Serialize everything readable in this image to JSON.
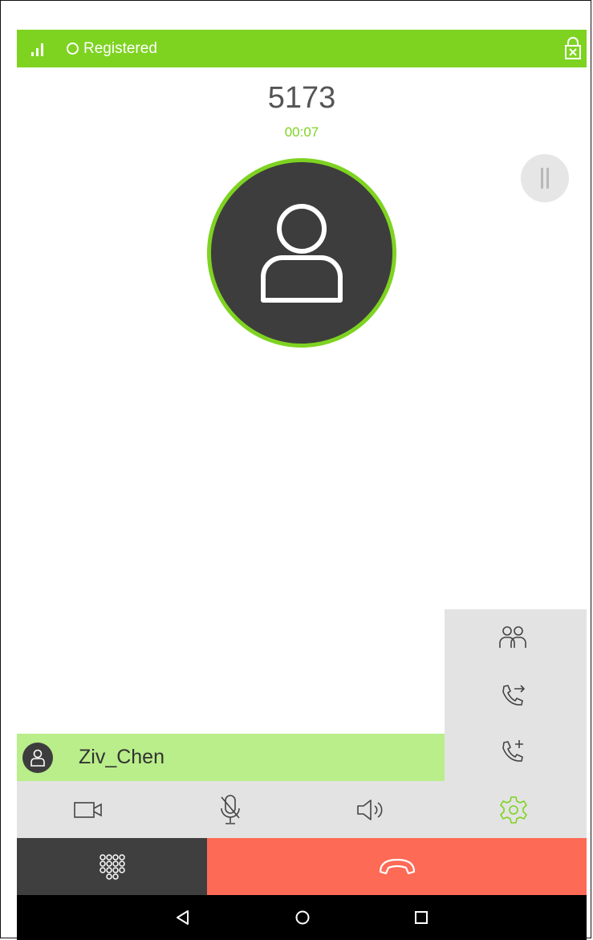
{
  "status": {
    "registration": "Registered",
    "signal_icon": "signal-icon",
    "lock_icon": "lock-icon",
    "color": "#7ed321"
  },
  "call": {
    "number": "5173",
    "timer": "00:07"
  },
  "contact": {
    "name": "Ziv_Chen",
    "bar_color": "#b9ee8a"
  },
  "side_actions": [
    {
      "icon": "conference-icon"
    },
    {
      "icon": "transfer-call-icon"
    },
    {
      "icon": "add-call-icon"
    }
  ],
  "controls": [
    {
      "icon": "video-icon"
    },
    {
      "icon": "mute-mic-icon"
    },
    {
      "icon": "speaker-icon"
    },
    {
      "icon": "settings-icon",
      "active": true
    }
  ],
  "actions": {
    "dialpad_icon": "dialpad-icon",
    "hangup_icon": "hangup-icon",
    "hangup_color": "#fd6a56"
  },
  "navbar": [
    "back-icon",
    "home-icon",
    "recents-icon"
  ]
}
